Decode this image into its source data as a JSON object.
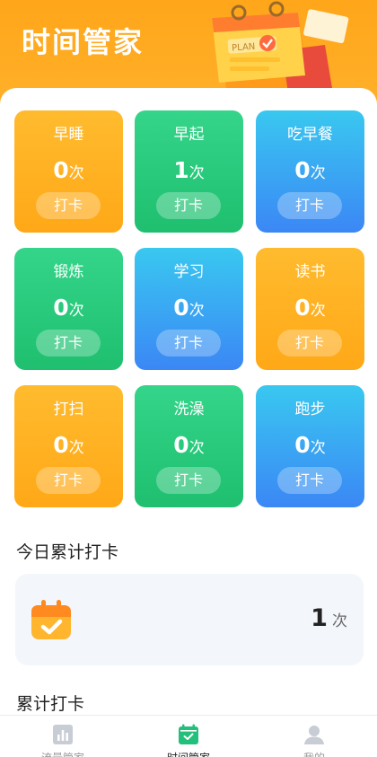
{
  "header": {
    "title": "时间管家"
  },
  "cards": [
    {
      "name": "早睡",
      "count": "0",
      "unit": "次",
      "button": "打卡",
      "color": "orange"
    },
    {
      "name": "早起",
      "count": "1",
      "unit": "次",
      "button": "打卡",
      "color": "green"
    },
    {
      "name": "吃早餐",
      "count": "0",
      "unit": "次",
      "button": "打卡",
      "color": "blue"
    },
    {
      "name": "锻炼",
      "count": "0",
      "unit": "次",
      "button": "打卡",
      "color": "green"
    },
    {
      "name": "学习",
      "count": "0",
      "unit": "次",
      "button": "打卡",
      "color": "blue"
    },
    {
      "name": "读书",
      "count": "0",
      "unit": "次",
      "button": "打卡",
      "color": "orange"
    },
    {
      "name": "打扫",
      "count": "0",
      "unit": "次",
      "button": "打卡",
      "color": "orange"
    },
    {
      "name": "洗澡",
      "count": "0",
      "unit": "次",
      "button": "打卡",
      "color": "green"
    },
    {
      "name": "跑步",
      "count": "0",
      "unit": "次",
      "button": "打卡",
      "color": "blue"
    }
  ],
  "today": {
    "title": "今日累计打卡",
    "count": "1",
    "unit": "次",
    "icon": "calendar-check-icon"
  },
  "total": {
    "title": "累计打卡"
  },
  "tabbar": {
    "items": [
      {
        "label": "流量管家",
        "icon": "bar-chart-icon",
        "active": false
      },
      {
        "label": "时间管家",
        "icon": "calendar-check-icon",
        "active": true
      },
      {
        "label": "我的",
        "icon": "user-icon",
        "active": false
      }
    ]
  },
  "colors": {
    "orange": "#ffa817",
    "green": "#1fbf6f",
    "blue": "#3b87f5",
    "header": "#ffa61a"
  }
}
